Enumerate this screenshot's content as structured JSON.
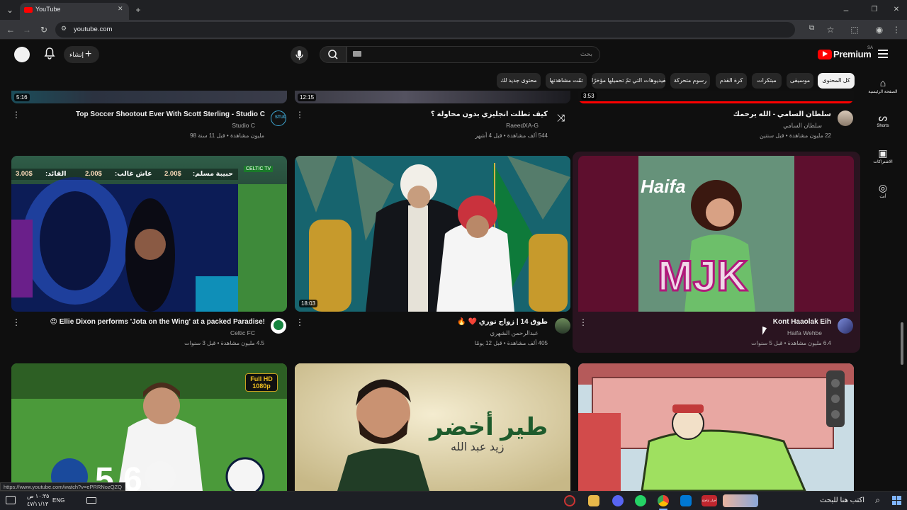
{
  "browser": {
    "tab_title": "YouTube",
    "url": "youtube.com",
    "status_url": "https://www.youtube.com/watch?v=ePRRNozQZQ"
  },
  "header": {
    "premium_label": "Premium",
    "premium_region": "SA",
    "search_placeholder": "بحث",
    "create_label": "إنشاء"
  },
  "chips": [
    "كل المحتوى",
    "موسيقى",
    "مبتكرات",
    "كرة القدم",
    "رسوم متحركة",
    "الفيديوهات التي تمّ تحميلها مؤخرًا",
    "تمّت مشاهدتها",
    "محتوى جديد لك"
  ],
  "sidebar": [
    {
      "label": "الصفحة الرئيسية",
      "icon": "home-icon"
    },
    {
      "label": "Shorts",
      "icon": "shorts-icon"
    },
    {
      "label": "الاشتراكات",
      "icon": "subscriptions-icon"
    },
    {
      "label": "أنت",
      "icon": "you-icon"
    }
  ],
  "row1": [
    {
      "title": "Top Soccer Shootout Ever With Scott Sterling - Studio C",
      "channel": "Studio C",
      "meta": "98 مليون مشاهدة • قبل 11 سنة",
      "duration": "5:16"
    },
    {
      "title": "كيف تطلت انجليزي بدون محاولة ؟",
      "channel": "RaeedXA-G",
      "meta": "544 ألف مشاهدة • قبل 4 أشهر",
      "duration": "12:15"
    },
    {
      "title": "سلطان السامي - الله يرحمك",
      "channel": "سلطان السامي",
      "meta": "22 مليون مشاهدة • قبل سنتين",
      "duration": "3:53"
    }
  ],
  "row2": [
    {
      "title": "Ellie Dixon performs 'Jota on the Wing' at a packed Paradise!",
      "emoji": "😍",
      "channel": "Celtic FC",
      "meta": "4.5 مليون مشاهدة • قبل 3 سنوات",
      "overlay_badge": "CELTIC TV",
      "overlay_names": [
        "القائد:",
        "عاش غالب:",
        "حبيبة مسلم:"
      ],
      "overlay_prices": [
        "3.00$",
        "2.00$",
        "2.00$"
      ]
    },
    {
      "title": "طوق 14 | زواج نوري ❤️ 🔥",
      "channel": "عبدالرحمن الشهري",
      "meta": "405 ألف مشاهدة • قبل 12 يومًا",
      "duration": "18:03"
    },
    {
      "title": "Kont Haaolak Eih",
      "channel": "Haifa Wehbe",
      "meta": "6.4 مليون مشاهدة • قبل 5 سنوات",
      "art_text": "MJK",
      "art_script": "Haifa"
    }
  ],
  "row3": [
    {
      "overlay": "Full HD 1080p",
      "score": "5 6"
    },
    {
      "title_ar": "طير أخضر",
      "subtitle_ar": "زيد عبد الله"
    },
    {}
  ],
  "taskbar": {
    "search_placeholder": "اكتب هنا للبحث",
    "lang": "ENG",
    "time": "١٠:٣٥ ص",
    "date": "٤٧/١١/١٣",
    "news_badge": "أخبار عاجلة"
  },
  "colors": {
    "yt_red": "#ff0000",
    "page_bg": "#0f0f0f",
    "chip_bg": "#272727",
    "hover_card": "#2a1420"
  }
}
